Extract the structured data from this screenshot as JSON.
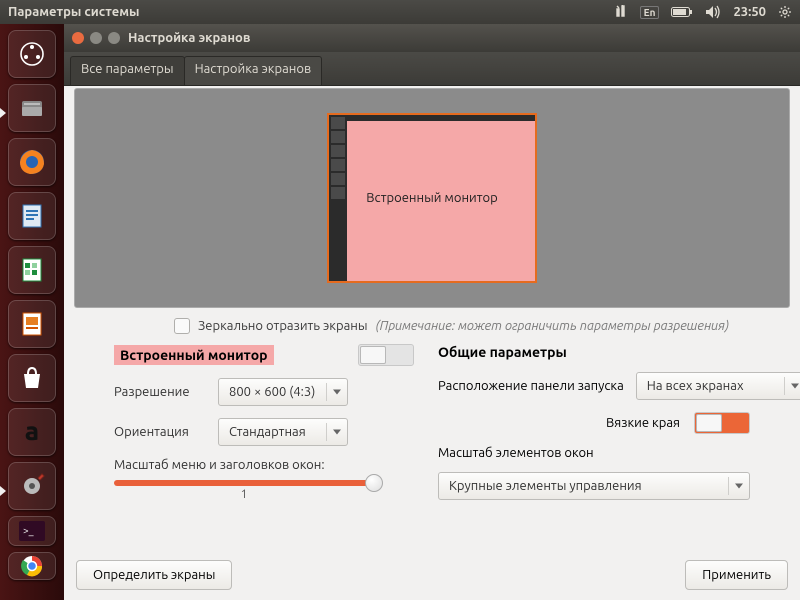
{
  "top_panel": {
    "title": "Параметры системы",
    "lang": "En",
    "time": "23:50"
  },
  "tooltip": "Встроенный монитор",
  "window": {
    "title": "Настройка экранов",
    "tabs": {
      "all": "Все параметры",
      "current": "Настройка экранов"
    }
  },
  "preview": {
    "monitor_name": "Встроенный монитор"
  },
  "mirror": {
    "label": "Зеркально отразить экраны",
    "note": "(Примечание: может ограничить параметры разрешения)"
  },
  "left": {
    "header": "Встроенный монитор",
    "resolution_label": "Разрешение",
    "resolution_value": "800 × 600 (4:3)",
    "orientation_label": "Ориентация",
    "orientation_value": "Стандартная",
    "scale_label": "Масштаб меню и заголовков окон:",
    "scale_value": "1"
  },
  "right": {
    "header": "Общие параметры",
    "launcher_pos_label": "Расположение панели запуска",
    "launcher_pos_value": "На всех экранах",
    "sticky_label": "Вязкие края",
    "scale_elems_label": "Масштаб элементов окон",
    "scale_elems_value": "Крупные элементы управления"
  },
  "buttons": {
    "detect": "Определить экраны",
    "apply": "Применить"
  },
  "launcher_items": [
    "dash",
    "files",
    "firefox",
    "writer",
    "calc",
    "impress",
    "software",
    "amazon",
    "settings",
    "terminal",
    "chrome"
  ]
}
